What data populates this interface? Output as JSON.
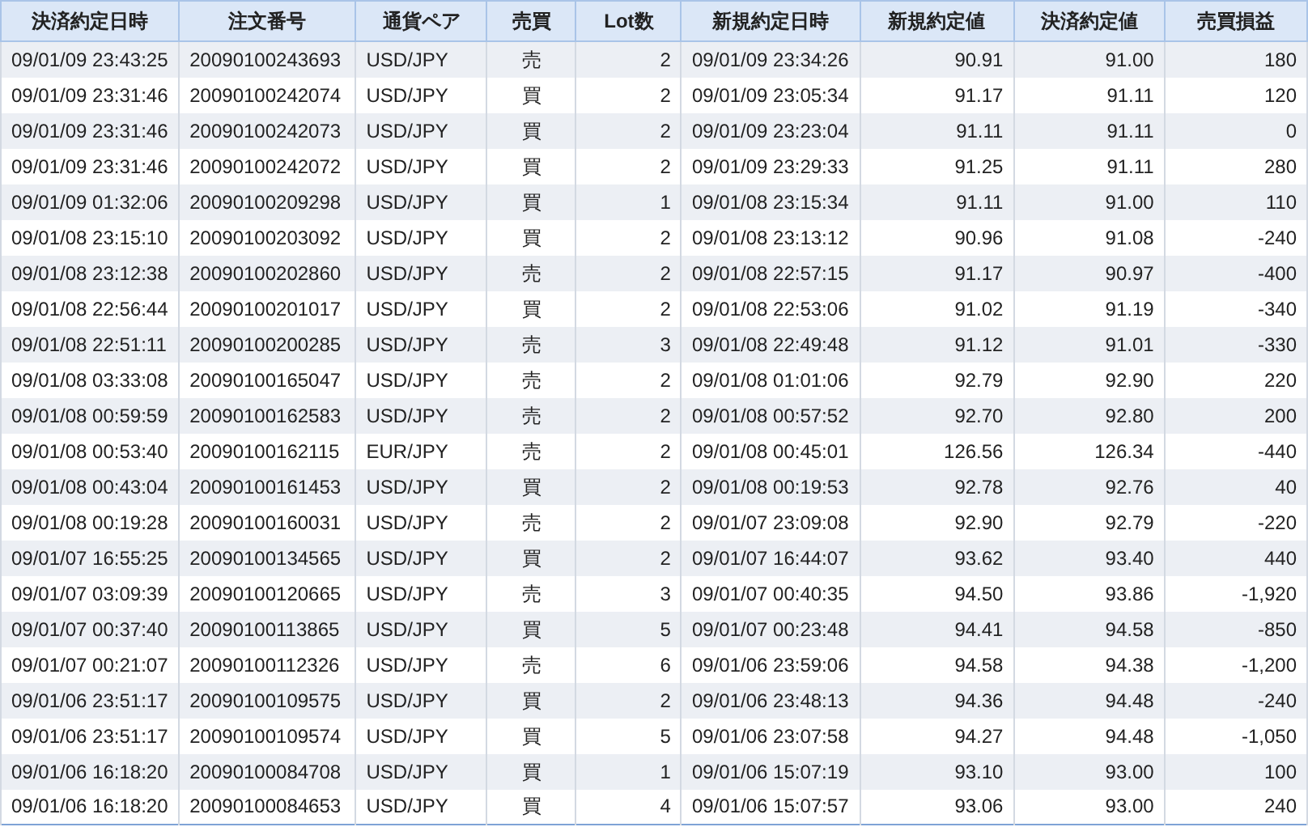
{
  "table": {
    "columns": [
      "決済約定日時",
      "注文番号",
      "通貨ペア",
      "売買",
      "Lot数",
      "新規約定日時",
      "新規約定値",
      "決済約定値",
      "売買損益"
    ],
    "rows": [
      [
        "09/01/09 23:43:25",
        "20090100243693",
        "USD/JPY",
        "売",
        "2",
        "09/01/09 23:34:26",
        "90.91",
        "91.00",
        "180"
      ],
      [
        "09/01/09 23:31:46",
        "20090100242074",
        "USD/JPY",
        "買",
        "2",
        "09/01/09 23:05:34",
        "91.17",
        "91.11",
        "120"
      ],
      [
        "09/01/09 23:31:46",
        "20090100242073",
        "USD/JPY",
        "買",
        "2",
        "09/01/09 23:23:04",
        "91.11",
        "91.11",
        "0"
      ],
      [
        "09/01/09 23:31:46",
        "20090100242072",
        "USD/JPY",
        "買",
        "2",
        "09/01/09 23:29:33",
        "91.25",
        "91.11",
        "280"
      ],
      [
        "09/01/09 01:32:06",
        "20090100209298",
        "USD/JPY",
        "買",
        "1",
        "09/01/08 23:15:34",
        "91.11",
        "91.00",
        "110"
      ],
      [
        "09/01/08 23:15:10",
        "20090100203092",
        "USD/JPY",
        "買",
        "2",
        "09/01/08 23:13:12",
        "90.96",
        "91.08",
        "-240"
      ],
      [
        "09/01/08 23:12:38",
        "20090100202860",
        "USD/JPY",
        "売",
        "2",
        "09/01/08 22:57:15",
        "91.17",
        "90.97",
        "-400"
      ],
      [
        "09/01/08 22:56:44",
        "20090100201017",
        "USD/JPY",
        "買",
        "2",
        "09/01/08 22:53:06",
        "91.02",
        "91.19",
        "-340"
      ],
      [
        "09/01/08 22:51:11",
        "20090100200285",
        "USD/JPY",
        "売",
        "3",
        "09/01/08 22:49:48",
        "91.12",
        "91.01",
        "-330"
      ],
      [
        "09/01/08 03:33:08",
        "20090100165047",
        "USD/JPY",
        "売",
        "2",
        "09/01/08 01:01:06",
        "92.79",
        "92.90",
        "220"
      ],
      [
        "09/01/08 00:59:59",
        "20090100162583",
        "USD/JPY",
        "売",
        "2",
        "09/01/08 00:57:52",
        "92.70",
        "92.80",
        "200"
      ],
      [
        "09/01/08 00:53:40",
        "20090100162115",
        "EUR/JPY",
        "売",
        "2",
        "09/01/08 00:45:01",
        "126.56",
        "126.34",
        "-440"
      ],
      [
        "09/01/08 00:43:04",
        "20090100161453",
        "USD/JPY",
        "買",
        "2",
        "09/01/08 00:19:53",
        "92.78",
        "92.76",
        "40"
      ],
      [
        "09/01/08 00:19:28",
        "20090100160031",
        "USD/JPY",
        "売",
        "2",
        "09/01/07 23:09:08",
        "92.90",
        "92.79",
        "-220"
      ],
      [
        "09/01/07 16:55:25",
        "20090100134565",
        "USD/JPY",
        "買",
        "2",
        "09/01/07 16:44:07",
        "93.62",
        "93.40",
        "440"
      ],
      [
        "09/01/07 03:09:39",
        "20090100120665",
        "USD/JPY",
        "売",
        "3",
        "09/01/07 00:40:35",
        "94.50",
        "93.86",
        "-1,920"
      ],
      [
        "09/01/07 00:37:40",
        "20090100113865",
        "USD/JPY",
        "買",
        "5",
        "09/01/07 00:23:48",
        "94.41",
        "94.58",
        "-850"
      ],
      [
        "09/01/07 00:21:07",
        "20090100112326",
        "USD/JPY",
        "売",
        "6",
        "09/01/06 23:59:06",
        "94.58",
        "94.38",
        "-1,200"
      ],
      [
        "09/01/06 23:51:17",
        "20090100109575",
        "USD/JPY",
        "買",
        "2",
        "09/01/06 23:48:13",
        "94.36",
        "94.48",
        "-240"
      ],
      [
        "09/01/06 23:51:17",
        "20090100109574",
        "USD/JPY",
        "買",
        "5",
        "09/01/06 23:07:58",
        "94.27",
        "94.48",
        "-1,050"
      ],
      [
        "09/01/06 16:18:20",
        "20090100084708",
        "USD/JPY",
        "買",
        "1",
        "09/01/06 15:07:19",
        "93.10",
        "93.00",
        "100"
      ],
      [
        "09/01/06 16:18:20",
        "20090100084653",
        "USD/JPY",
        "買",
        "4",
        "09/01/06 15:07:57",
        "93.06",
        "93.00",
        "240"
      ]
    ]
  }
}
